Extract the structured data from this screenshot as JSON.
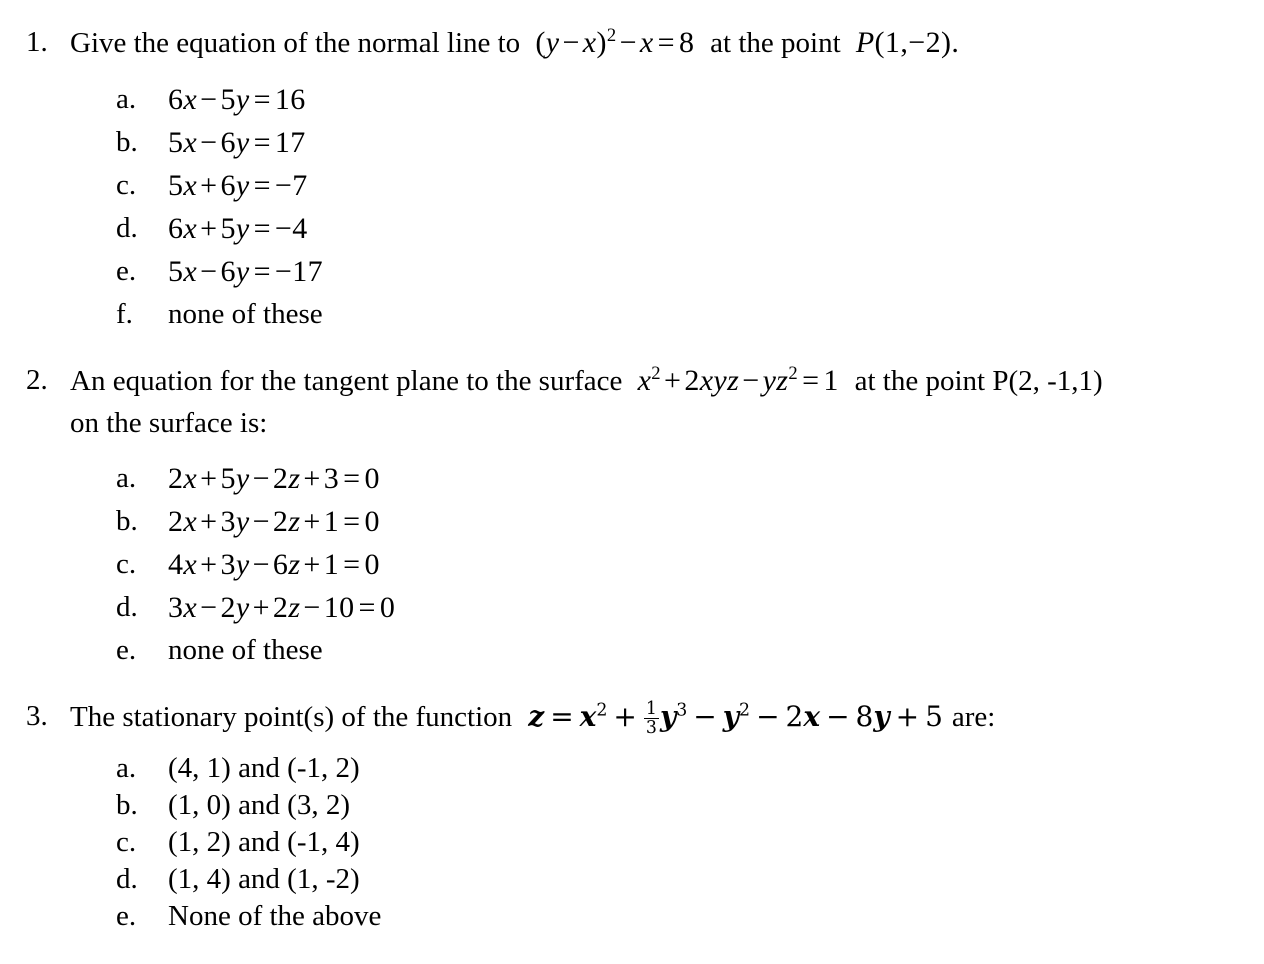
{
  "document": {
    "background_color": "#ffffff",
    "text_color": "#000000"
  },
  "questions": [
    {
      "number": "1.",
      "stem_prefix": "Give the equation of the normal line to",
      "stem_suffix": "at the point",
      "equation": "(y − x)² − x = 8",
      "point": "P(1, −2).",
      "options": [
        {
          "letter": "a.",
          "text": "6x − 5y = 16"
        },
        {
          "letter": "b.",
          "text": "5x − 6y = 17"
        },
        {
          "letter": "c.",
          "text": "5x + 6y = −7"
        },
        {
          "letter": "d.",
          "text": "6x + 5y = −4"
        },
        {
          "letter": "e.",
          "text": "5x − 6y = −17"
        },
        {
          "letter": "f.",
          "text": "none of these"
        }
      ]
    },
    {
      "number": "2.",
      "stem_prefix": "An equation for the tangent plane to the surface",
      "stem_suffix": "at the point P(2, -1,1)",
      "stem_line2": "on the surface is:",
      "equation": "x² + 2xyz − yz² = 1",
      "options": [
        {
          "letter": "a.",
          "text": "2x + 5y − 2z + 3 = 0"
        },
        {
          "letter": "b.",
          "text": "2x + 3y − 2z + 1 = 0"
        },
        {
          "letter": "c.",
          "text": "4x + 3y − 6z + 1 = 0"
        },
        {
          "letter": "d.",
          "text": "3x − 2y + 2z − 10 = 0"
        },
        {
          "letter": "e.",
          "text": "none of these"
        }
      ]
    },
    {
      "number": "3.",
      "stem_prefix": "The stationary point(s) of the function",
      "stem_suffix": "are:",
      "equation": "z = x² + (1/3)y³ − y² − 2x − 8y + 5",
      "fraction": {
        "numerator": "1",
        "denominator": "3"
      },
      "options": [
        {
          "letter": "a.",
          "text": "(4, 1) and (-1, 2)"
        },
        {
          "letter": "b.",
          "text": "(1, 0) and (3, 2)"
        },
        {
          "letter": "c.",
          "text": "(1, 2) and (-1, 4)"
        },
        {
          "letter": "d.",
          "text": "(1, 4) and (1, -2)"
        },
        {
          "letter": "e.",
          "text": "None of the above"
        }
      ]
    }
  ]
}
